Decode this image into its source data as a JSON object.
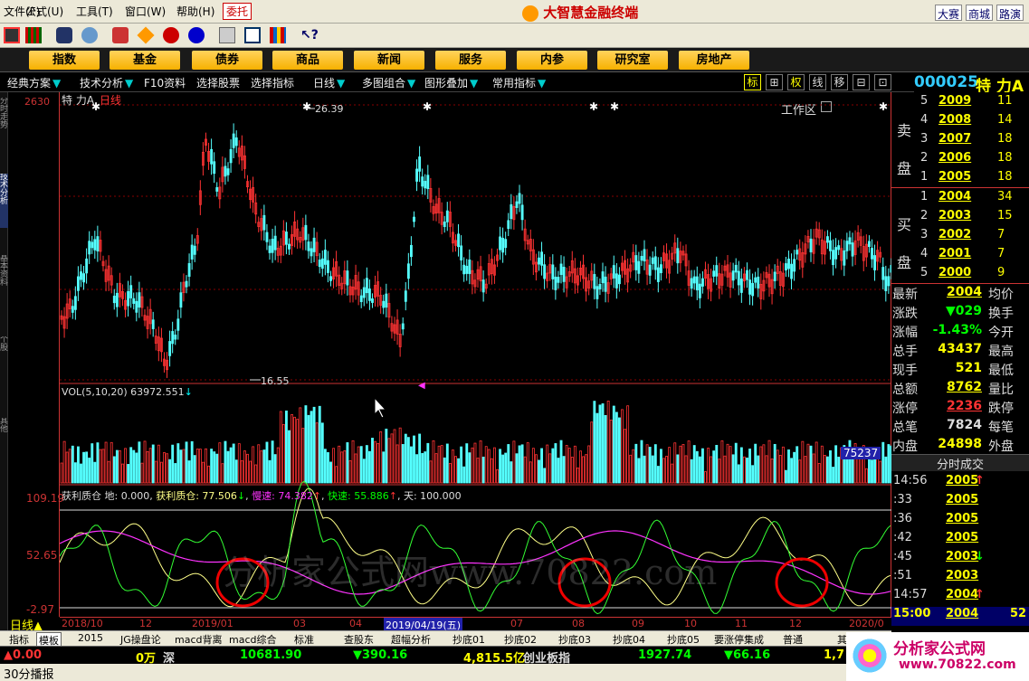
{
  "menu": [
    "文件(F)",
    "公式(U)",
    "工具(T)",
    "窗口(W)",
    "帮助(H)"
  ],
  "menu_entrust": "委托",
  "app_title": "大智慧金融终端",
  "corner_links": [
    "大赛",
    "商城",
    "路演"
  ],
  "categories": [
    "指数",
    "基金",
    "债券",
    "商品",
    "新闻",
    "服务",
    "内参",
    "研究室",
    "房地产"
  ],
  "workspace": "工作区",
  "func_tabs": [
    "经典方案",
    "技术分析",
    "F10资料",
    "选择股票",
    "选择指标",
    "日线",
    "多图组合",
    "图形叠加",
    "常用指标"
  ],
  "view_icons": [
    "标",
    "⊞",
    "权",
    "线",
    "移",
    "⊟",
    "⊡"
  ],
  "stock": {
    "code": "000025",
    "name": "特 力A"
  },
  "chart_title": "特 力A",
  "chart_period": "日线",
  "price_axis_top": "2630",
  "annot_high": "26.39",
  "annot_low": "16.55",
  "vol_header": "VOL(5,10,20) 63972.551",
  "vol_last": "75237",
  "ind_header": {
    "name": "获利质仓",
    "p1": "地: 0.000,",
    "p2": "获利质仓: 77.506",
    "p3": "慢速: 74.382",
    "p4": "快速: 55.886",
    "p5": "天: 100.000"
  },
  "ind_axis": [
    "109.19",
    "52.65",
    "-2.97"
  ],
  "watermark": "分析家公式网www.70822.com",
  "date_axis": {
    "period": "日线",
    "labels": [
      "2018/10",
      "12",
      "2019/01",
      "03",
      "04",
      "2019/04/19(五)",
      "07",
      "08",
      "09",
      "10",
      "11",
      "12",
      "2020/0"
    ]
  },
  "left_vertical": [
    "分时走势",
    "技术分析",
    "基本资料",
    "个股",
    "其他"
  ],
  "orderbook": {
    "sell_label": [
      "卖",
      "盘"
    ],
    "buy_label": [
      "买",
      "盘"
    ],
    "sell": [
      {
        "lvl": "5",
        "price": "2009",
        "vol": "11"
      },
      {
        "lvl": "4",
        "price": "2008",
        "vol": "14"
      },
      {
        "lvl": "3",
        "price": "2007",
        "vol": "18"
      },
      {
        "lvl": "2",
        "price": "2006",
        "vol": "18"
      },
      {
        "lvl": "1",
        "price": "2005",
        "vol": "18"
      }
    ],
    "buy": [
      {
        "lvl": "1",
        "price": "2004",
        "vol": "34"
      },
      {
        "lvl": "2",
        "price": "2003",
        "vol": "15"
      },
      {
        "lvl": "3",
        "price": "2002",
        "vol": "7"
      },
      {
        "lvl": "4",
        "price": "2001",
        "vol": "7"
      },
      {
        "lvl": "5",
        "price": "2000",
        "vol": "9"
      }
    ]
  },
  "stats": [
    {
      "l": "最新",
      "v": "2004",
      "c": "#ff0",
      "r": "均价"
    },
    {
      "l": "涨跌",
      "v": "▼029",
      "c": "#0f0",
      "r": "换手"
    },
    {
      "l": "涨幅",
      "v": "-1.43%",
      "c": "#0f0",
      "r": "今开"
    },
    {
      "l": "总手",
      "v": "43437",
      "c": "#ff0",
      "r": "最高"
    },
    {
      "l": "现手",
      "v": "521",
      "c": "#ff0",
      "r": "最低"
    },
    {
      "l": "总额",
      "v": "8762",
      "c": "#ff0",
      "r": "量比"
    },
    {
      "l": "涨停",
      "v": "2236",
      "c": "#f33",
      "r": "跌停"
    },
    {
      "l": "总笔",
      "v": "7824",
      "c": "#ddd",
      "r": "每笔"
    },
    {
      "l": "内盘",
      "v": "24898",
      "c": "#ff0",
      "r": "外盘"
    }
  ],
  "ticks_title": "分时成交",
  "ticks": [
    {
      "t": "14:56",
      "p": "2005",
      "m": "↑",
      "mc": "#f33"
    },
    {
      "t": ":33",
      "p": "2005",
      "m": "",
      "mc": ""
    },
    {
      "t": ":36",
      "p": "2005",
      "m": "",
      "mc": ""
    },
    {
      "t": ":42",
      "p": "2005",
      "m": "",
      "mc": ""
    },
    {
      "t": ":45",
      "p": "2003",
      "m": "↓",
      "mc": "#0f0"
    },
    {
      "t": ":51",
      "p": "2003",
      "m": "",
      "mc": ""
    },
    {
      "t": "14:57",
      "p": "2004",
      "m": "↑",
      "mc": "#f33"
    },
    {
      "t": "15:00",
      "p": "2004",
      "m": "",
      "mc": "",
      "last": "52"
    }
  ],
  "bottom_tabs": [
    "指标",
    "模板",
    "2015",
    "JG操盘论",
    "macd背离",
    "macd综合",
    "标准",
    "查股东",
    "超幅分析",
    "抄底01",
    "抄底02",
    "抄底03",
    "抄底04",
    "抄底05",
    "要涨停集成",
    "普通",
    "其"
  ],
  "status": {
    "a": "▲0.00",
    "b": "0万",
    "c": "深",
    "d": "10681.90",
    "e": "▼390.16",
    "f": "4,815.5亿",
    "g": "创业板指",
    "h": "1927.74",
    "i": "▼66.16",
    "j": "1,7"
  },
  "status2": "30分播报",
  "logo_text": "分析家公式网",
  "logo_url": "www.70822.com"
}
